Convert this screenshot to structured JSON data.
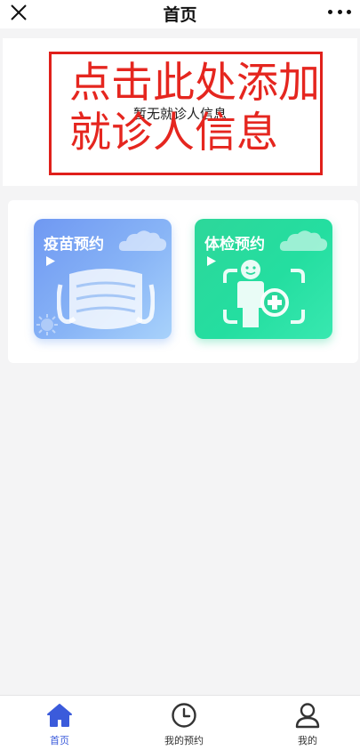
{
  "topbar": {
    "title": "首页",
    "close_icon": "close-icon",
    "more_icon": "more-dots-icon"
  },
  "patient": {
    "empty_text": "暂无就诊人信息"
  },
  "annotation": {
    "line1": "点击此处添加",
    "line2": "就诊人信息",
    "color": "#e5261f"
  },
  "services": [
    {
      "label": "疫苗预约",
      "icon": "face-mask-icon",
      "color": "#7ba6f4"
    },
    {
      "label": "体检预约",
      "icon": "body-scan-icon",
      "color": "#2bdb9e"
    }
  ],
  "tabbar": {
    "items": [
      {
        "label": "首页",
        "icon": "home-icon",
        "active": true
      },
      {
        "label": "我的预约",
        "icon": "clock-icon",
        "active": false
      },
      {
        "label": "我的",
        "icon": "user-icon",
        "active": false
      }
    ],
    "active_color": "#3b5bdb"
  }
}
